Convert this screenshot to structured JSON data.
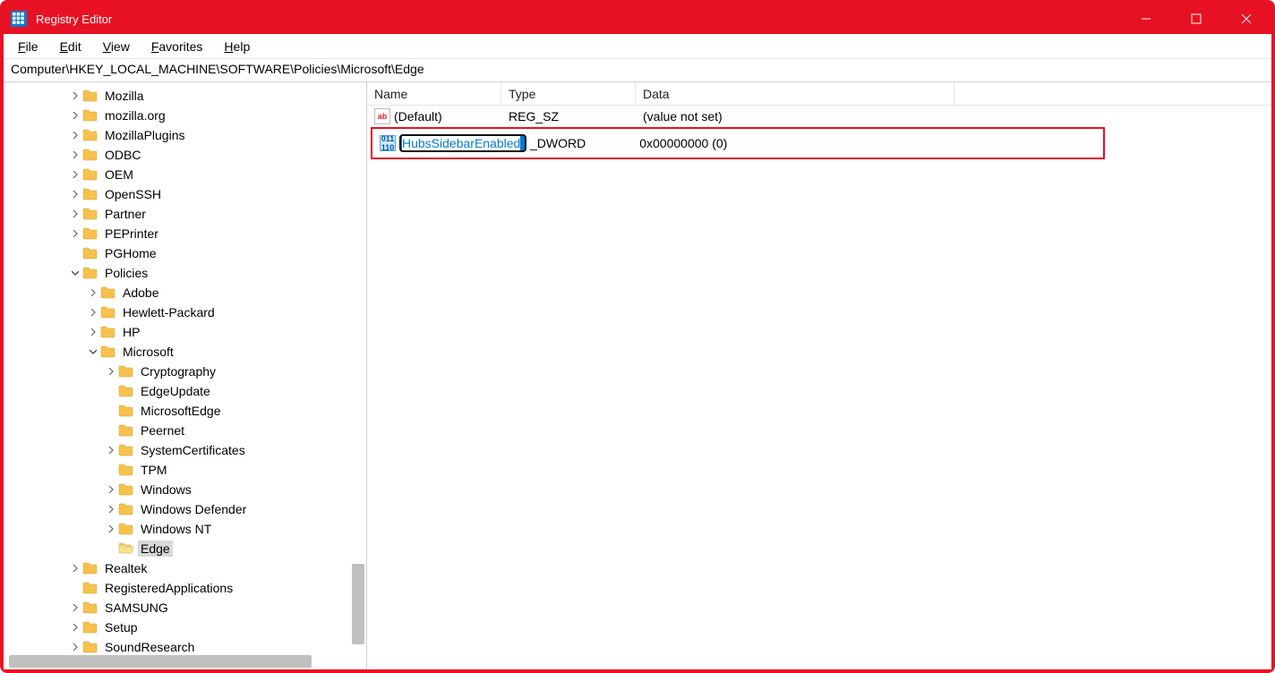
{
  "titlebar": {
    "title": "Registry Editor"
  },
  "menubar": {
    "file": "File",
    "edit": "Edit",
    "view": "View",
    "favorites": "Favorites",
    "help": "Help"
  },
  "address": {
    "path": "Computer\\HKEY_LOCAL_MACHINE\\SOFTWARE\\Policies\\Microsoft\\Edge"
  },
  "tree": [
    {
      "indent": 72,
      "twisty": ">",
      "label": "Mozilla"
    },
    {
      "indent": 72,
      "twisty": ">",
      "label": "mozilla.org"
    },
    {
      "indent": 72,
      "twisty": ">",
      "label": "MozillaPlugins"
    },
    {
      "indent": 72,
      "twisty": ">",
      "label": "ODBC"
    },
    {
      "indent": 72,
      "twisty": ">",
      "label": "OEM"
    },
    {
      "indent": 72,
      "twisty": ">",
      "label": "OpenSSH"
    },
    {
      "indent": 72,
      "twisty": ">",
      "label": "Partner"
    },
    {
      "indent": 72,
      "twisty": ">",
      "label": "PEPrinter"
    },
    {
      "indent": 72,
      "twisty": "",
      "label": "PGHome"
    },
    {
      "indent": 72,
      "twisty": "v",
      "label": "Policies"
    },
    {
      "indent": 92,
      "twisty": ">",
      "label": "Adobe"
    },
    {
      "indent": 92,
      "twisty": ">",
      "label": "Hewlett-Packard"
    },
    {
      "indent": 92,
      "twisty": ">",
      "label": "HP"
    },
    {
      "indent": 92,
      "twisty": "v",
      "label": "Microsoft"
    },
    {
      "indent": 112,
      "twisty": ">",
      "label": "Cryptography"
    },
    {
      "indent": 112,
      "twisty": "",
      "label": "EdgeUpdate"
    },
    {
      "indent": 112,
      "twisty": "",
      "label": "MicrosoftEdge"
    },
    {
      "indent": 112,
      "twisty": "",
      "label": "Peernet"
    },
    {
      "indent": 112,
      "twisty": ">",
      "label": "SystemCertificates"
    },
    {
      "indent": 112,
      "twisty": "",
      "label": "TPM"
    },
    {
      "indent": 112,
      "twisty": ">",
      "label": "Windows"
    },
    {
      "indent": 112,
      "twisty": ">",
      "label": "Windows Defender"
    },
    {
      "indent": 112,
      "twisty": ">",
      "label": "Windows NT"
    },
    {
      "indent": 112,
      "twisty": "",
      "label": "Edge",
      "selected": true,
      "open": true
    },
    {
      "indent": 72,
      "twisty": ">",
      "label": "Realtek"
    },
    {
      "indent": 72,
      "twisty": "",
      "label": "RegisteredApplications"
    },
    {
      "indent": 72,
      "twisty": ">",
      "label": "SAMSUNG"
    },
    {
      "indent": 72,
      "twisty": ">",
      "label": "Setup"
    },
    {
      "indent": 72,
      "twisty": ">",
      "label": "SoundResearch"
    }
  ],
  "list": {
    "headers": {
      "name": "Name",
      "type": "Type",
      "data": "Data"
    },
    "rows": [
      {
        "icon": "sz",
        "name": "(Default)",
        "type": "REG_SZ",
        "data": "(value not set)"
      }
    ],
    "rename_row": {
      "icon": "dw",
      "name_value": "HubsSidebarEnabled",
      "type": "_DWORD",
      "data": "0x00000000 (0)"
    }
  }
}
